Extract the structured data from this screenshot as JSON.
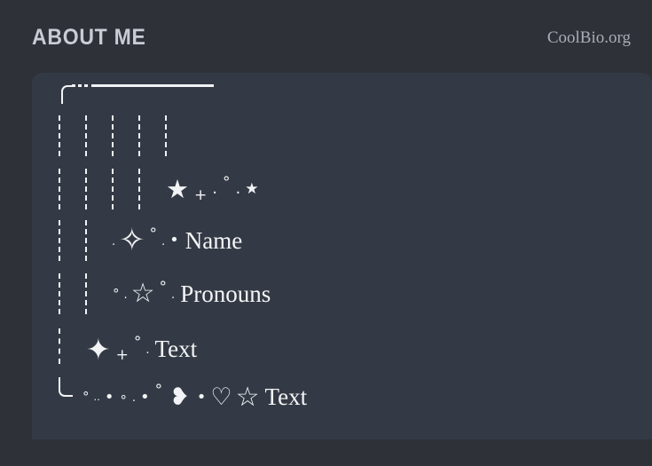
{
  "header": {
    "title": "ABOUT ME",
    "brand": "CoolBio.org"
  },
  "theme": {
    "page_bg": "#2e3137",
    "panel_bg": "#343a45",
    "ink": "#f2f3f5",
    "title_color": "#c8ccd4",
    "brand_color": "#a9adb6"
  },
  "bio_art": {
    "rows": [
      {
        "id": "top-border",
        "kind": "border-top",
        "text": "╭┄┄──────────────"
      },
      {
        "id": "bars-5",
        "kind": "bars",
        "bar_count": 5,
        "text": "┊ ┊ ┊ ┊ ┊"
      },
      {
        "id": "stars",
        "kind": "bars-glyphs",
        "bar_count": 4,
        "text": "┊ ┊ ┊ ┊  ★ ＋ · ° · ★",
        "glyphs": [
          "★",
          "+",
          "·",
          "°",
          "·",
          "★"
        ]
      },
      {
        "id": "name",
        "kind": "bars-glyphs-label",
        "bar_count": 2,
        "text": "┊ ┊ . ✧ ° . • Name",
        "glyphs": [
          ".",
          "✧",
          "°",
          ".",
          "•"
        ],
        "label": "Name"
      },
      {
        "id": "pronouns",
        "kind": "bars-glyphs-label",
        "bar_count": 2,
        "text": "┊ ┊ ° . ☆ ° . Pronouns",
        "glyphs": [
          "°",
          ".",
          "☆",
          "°",
          "."
        ],
        "label": "Pronouns"
      },
      {
        "id": "text-1",
        "kind": "bars-glyphs-label",
        "bar_count": 1,
        "text": "┊  ✦ ＋ ° . Text",
        "glyphs": [
          "✦",
          "+",
          "°",
          "."
        ],
        "label": "Text"
      },
      {
        "id": "text-2",
        "kind": "border-bottom-glyphs-label",
        "text": "╰ ° . . • ∘ . • ° ❥ • ♡ ☆ Text",
        "glyphs": [
          "°",
          "..",
          "•",
          "∘",
          ".",
          "•",
          "°",
          "❥",
          "•",
          "♡",
          "☆"
        ],
        "label": "Text"
      }
    ]
  }
}
